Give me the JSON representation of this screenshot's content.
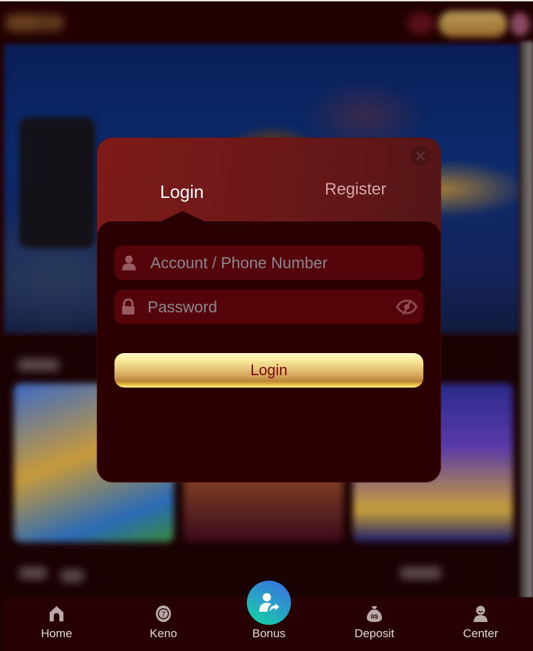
{
  "modal": {
    "tabs": [
      {
        "label": "Login",
        "active": true
      },
      {
        "label": "Register",
        "active": false
      }
    ],
    "close_icon": "close-icon",
    "fields": {
      "account": {
        "placeholder": "Account / Phone Number",
        "value": "",
        "icon": "user-icon"
      },
      "password": {
        "placeholder": "Password",
        "value": "",
        "icon": "lock-icon",
        "toggle_icon": "eye-slash-icon"
      }
    },
    "submit_label": "Login"
  },
  "bottom_nav": {
    "items": [
      {
        "label": "Home",
        "icon": "home-icon"
      },
      {
        "label": "Keno",
        "icon": "keno-ball-icon"
      },
      {
        "label": "Bonus",
        "icon": "user-share-icon"
      },
      {
        "label": "Deposit",
        "icon": "money-bag-icon",
        "icon_text": "R$"
      },
      {
        "label": "Center",
        "icon": "profile-icon"
      }
    ]
  },
  "colors": {
    "background": "#230002",
    "modal_header": "#7e1a1a",
    "modal_body": "#2a0002",
    "input_bg": "#55040a",
    "button_text": "#7a0a0a",
    "bonus_gradient_start": "#3a6ae0",
    "bonus_gradient_end": "#12d8a0"
  }
}
